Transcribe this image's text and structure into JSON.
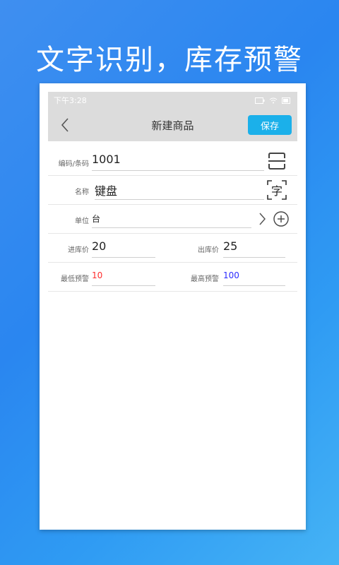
{
  "headline": "文字识别，库存预警",
  "status": {
    "time": "下午3:28"
  },
  "appbar": {
    "title": "新建商品",
    "save_label": "保存"
  },
  "form": {
    "code": {
      "label": "编码/条码",
      "value": "1001"
    },
    "name": {
      "label": "名称",
      "value": "键盘",
      "ocr_glyph": "字"
    },
    "unit": {
      "label": "单位",
      "value": "台"
    },
    "in_price": {
      "label": "进库价",
      "value": "20"
    },
    "out_price": {
      "label": "出库价",
      "value": "25"
    },
    "min_warn": {
      "label": "最低预警",
      "value": "10",
      "color": "#ff2d2d"
    },
    "max_warn": {
      "label": "最高预警",
      "value": "100",
      "color": "#2b2bff"
    }
  }
}
